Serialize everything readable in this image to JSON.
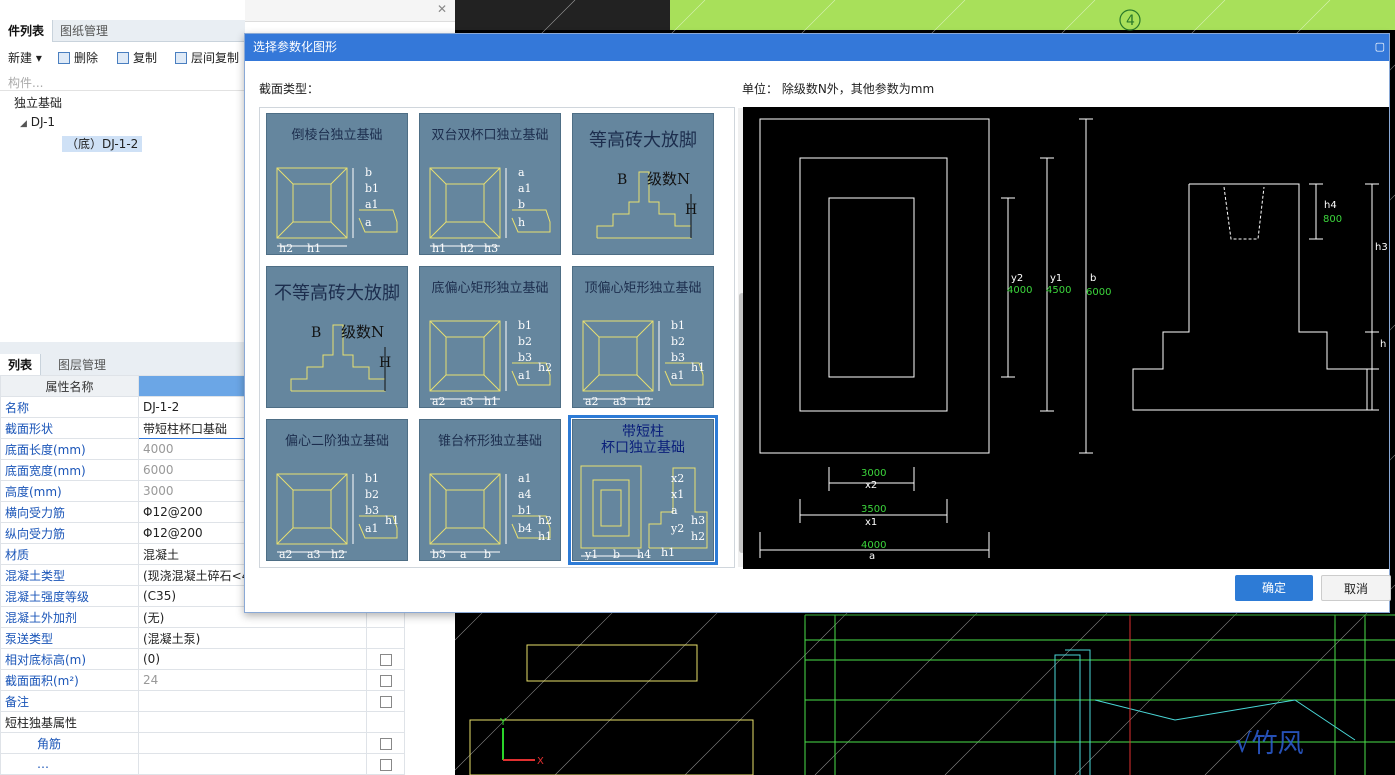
{
  "top_tabs": [
    "件列表",
    "图纸管理"
  ],
  "toolbar": {
    "new": "新建",
    "delete": "删除",
    "copy": "复制",
    "floor_copy": "层间复制"
  },
  "search_placeholder": "构件...",
  "tree": {
    "root": "独立基础",
    "child": "DJ-1",
    "leaf": "（底）DJ-1-2"
  },
  "mid_tabs": [
    "列表",
    "图层管理"
  ],
  "props": {
    "header": "属性名称",
    "header2": "属",
    "rows": [
      {
        "name": "名称",
        "value": "DJ-1-2"
      },
      {
        "name": "截面形状",
        "value": "带短柱杯口基础"
      },
      {
        "name": "底面长度(mm)",
        "value": "4000"
      },
      {
        "name": "底面宽度(mm)",
        "value": "6000"
      },
      {
        "name": "高度(mm)",
        "value": "3000"
      },
      {
        "name": "横向受力筋",
        "value": "Φ12@200"
      },
      {
        "name": "纵向受力筋",
        "value": "Φ12@200"
      },
      {
        "name": "材质",
        "value": "混凝土"
      },
      {
        "name": "混凝土类型",
        "value": "(现浇混凝土碎石<4"
      },
      {
        "name": "混凝土强度等级",
        "value": "(C35)"
      },
      {
        "name": "混凝土外加剂",
        "value": "(无)"
      },
      {
        "name": "泵送类型",
        "value": "(混凝土泵)"
      },
      {
        "name": "相对底标高(m)",
        "value": "(0)"
      },
      {
        "name": "截面面积(m²)",
        "value": "24"
      },
      {
        "name": "备注",
        "value": ""
      },
      {
        "name": "短柱独基属性",
        "value": ""
      },
      {
        "name": "角筋",
        "value": ""
      },
      {
        "name": "…",
        "value": ""
      }
    ]
  },
  "dialog": {
    "title": "选择参数化图形",
    "section_label": "截面类型：",
    "unit_label": "单位：  除级数N外，其他参数为mm",
    "ok": "确定",
    "cancel": "取消",
    "cells": [
      {
        "title": "倒棱台独立基础",
        "labels": [
          "b",
          "b1",
          "a1",
          "a",
          "h2",
          "h1"
        ]
      },
      {
        "title": "双台双杯口独立基础",
        "labels": [
          "a",
          "a1",
          "b",
          "h",
          "h1",
          "h2",
          "h3"
        ]
      },
      {
        "title": "等高砖大放脚",
        "labels": [
          "B",
          "级数N",
          "H"
        ]
      },
      {
        "title": "不等高砖大放脚",
        "labels": [
          "B",
          "级数N",
          "H"
        ]
      },
      {
        "title": "底偏心矩形独立基础",
        "labels": [
          "b1",
          "b2",
          "b3",
          "a1",
          "a2",
          "a3",
          "h1",
          "h2"
        ]
      },
      {
        "title": "顶偏心矩形独立基础",
        "labels": [
          "b1",
          "b2",
          "b3",
          "a1",
          "a2",
          "a3",
          "h2",
          "h1"
        ]
      },
      {
        "title": "偏心二阶独立基础",
        "labels": [
          "b1",
          "b2",
          "b3",
          "a1",
          "a2",
          "a3",
          "h2",
          "h1"
        ]
      },
      {
        "title": "锥台杯形独立基础",
        "labels": [
          "a1",
          "a4",
          "b1",
          "b4",
          "b3",
          "a",
          "b",
          "h2",
          "h1"
        ]
      },
      {
        "title": "带短柱\n杯口独立基础",
        "labels": [
          "x2",
          "x1",
          "a",
          "y2",
          "y1",
          "b",
          "h4",
          "h3",
          "h2",
          "h1"
        ]
      }
    ],
    "preview": {
      "dims": {
        "y2": "4000",
        "y1": "4500",
        "b": "6000",
        "h4": "800",
        "x2": "3000",
        "x1": "3500",
        "a": "4000"
      },
      "names": {
        "y2": "y2",
        "y1": "y1",
        "b": "b",
        "h4": "h4",
        "x2": "x2",
        "x1": "x1",
        "a": "a",
        "h3": "h3",
        "h": "h"
      }
    }
  },
  "cad": {
    "axis_label": "4",
    "x_axis": "X",
    "y_axis": "Y"
  }
}
